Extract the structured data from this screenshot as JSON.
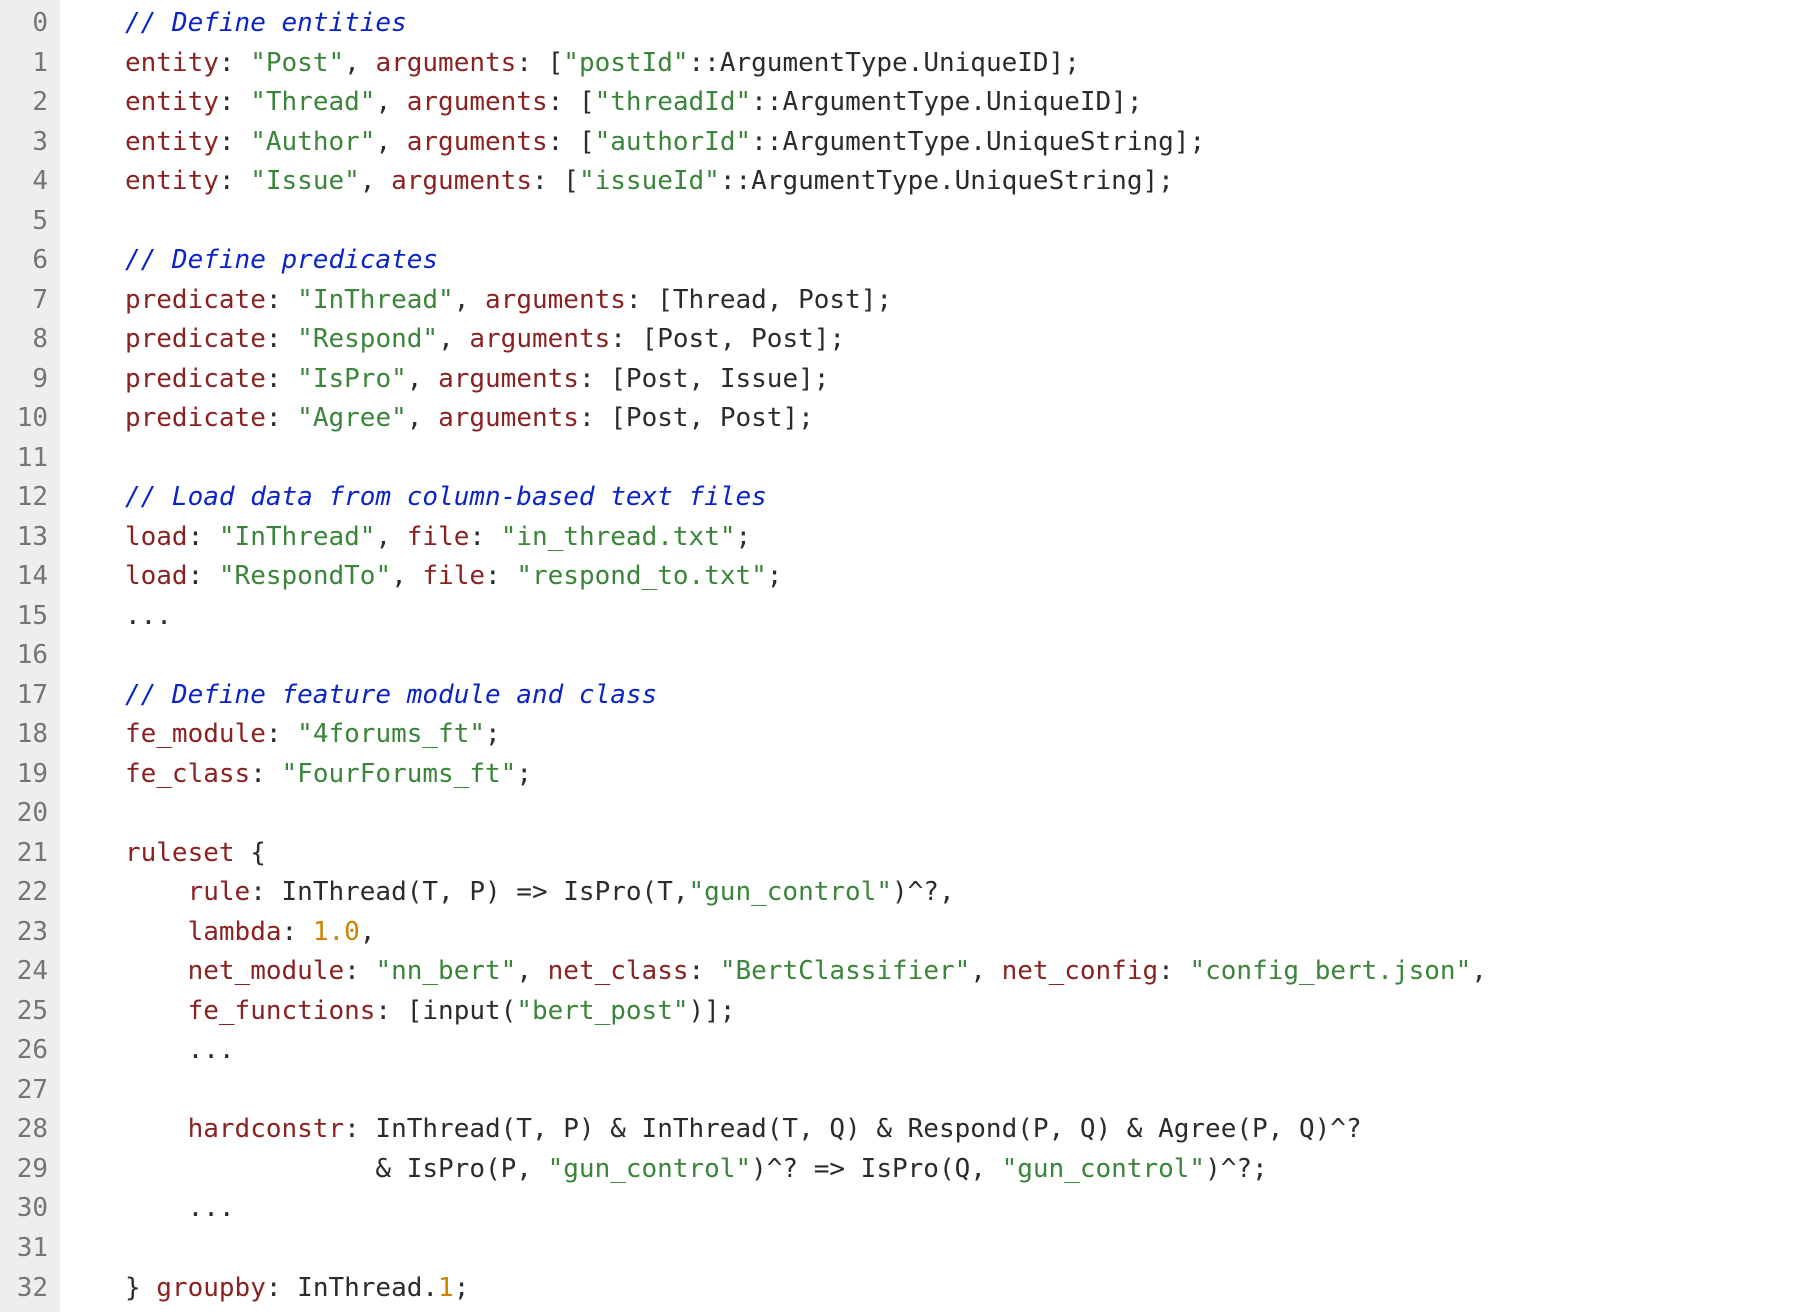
{
  "lines": [
    {
      "n": "0",
      "tokens": [
        [
          "txt",
          "   "
        ],
        [
          "comment",
          "// Define entities"
        ]
      ]
    },
    {
      "n": "1",
      "tokens": [
        [
          "txt",
          "   "
        ],
        [
          "key",
          "entity"
        ],
        [
          "txt",
          ": "
        ],
        [
          "str",
          "\"Post\""
        ],
        [
          "txt",
          ", "
        ],
        [
          "key",
          "arguments"
        ],
        [
          "txt",
          ": ["
        ],
        [
          "str",
          "\"postId\""
        ],
        [
          "txt",
          "::ArgumentType.UniqueID];"
        ]
      ]
    },
    {
      "n": "2",
      "tokens": [
        [
          "txt",
          "   "
        ],
        [
          "key",
          "entity"
        ],
        [
          "txt",
          ": "
        ],
        [
          "str",
          "\"Thread\""
        ],
        [
          "txt",
          ", "
        ],
        [
          "key",
          "arguments"
        ],
        [
          "txt",
          ": ["
        ],
        [
          "str",
          "\"threadId\""
        ],
        [
          "txt",
          "::ArgumentType.UniqueID];"
        ]
      ]
    },
    {
      "n": "3",
      "tokens": [
        [
          "txt",
          "   "
        ],
        [
          "key",
          "entity"
        ],
        [
          "txt",
          ": "
        ],
        [
          "str",
          "\"Author\""
        ],
        [
          "txt",
          ", "
        ],
        [
          "key",
          "arguments"
        ],
        [
          "txt",
          ": ["
        ],
        [
          "str",
          "\"authorId\""
        ],
        [
          "txt",
          "::ArgumentType.UniqueString];"
        ]
      ]
    },
    {
      "n": "4",
      "tokens": [
        [
          "txt",
          "   "
        ],
        [
          "key",
          "entity"
        ],
        [
          "txt",
          ": "
        ],
        [
          "str",
          "\"Issue\""
        ],
        [
          "txt",
          ", "
        ],
        [
          "key",
          "arguments"
        ],
        [
          "txt",
          ": ["
        ],
        [
          "str",
          "\"issueId\""
        ],
        [
          "txt",
          "::ArgumentType.UniqueString];"
        ]
      ]
    },
    {
      "n": "5",
      "tokens": [
        [
          "txt",
          " "
        ]
      ]
    },
    {
      "n": "6",
      "tokens": [
        [
          "txt",
          "   "
        ],
        [
          "comment",
          "// Define predicates"
        ]
      ]
    },
    {
      "n": "7",
      "tokens": [
        [
          "txt",
          "   "
        ],
        [
          "key",
          "predicate"
        ],
        [
          "txt",
          ": "
        ],
        [
          "str",
          "\"InThread\""
        ],
        [
          "txt",
          ", "
        ],
        [
          "key",
          "arguments"
        ],
        [
          "txt",
          ": [Thread, Post];"
        ]
      ]
    },
    {
      "n": "8",
      "tokens": [
        [
          "txt",
          "   "
        ],
        [
          "key",
          "predicate"
        ],
        [
          "txt",
          ": "
        ],
        [
          "str",
          "\"Respond\""
        ],
        [
          "txt",
          ", "
        ],
        [
          "key",
          "arguments"
        ],
        [
          "txt",
          ": [Post, Post];"
        ]
      ]
    },
    {
      "n": "9",
      "tokens": [
        [
          "txt",
          "   "
        ],
        [
          "key",
          "predicate"
        ],
        [
          "txt",
          ": "
        ],
        [
          "str",
          "\"IsPro\""
        ],
        [
          "txt",
          ", "
        ],
        [
          "key",
          "arguments"
        ],
        [
          "txt",
          ": [Post, Issue];"
        ]
      ]
    },
    {
      "n": "10",
      "tokens": [
        [
          "txt",
          "   "
        ],
        [
          "key",
          "predicate"
        ],
        [
          "txt",
          ": "
        ],
        [
          "str",
          "\"Agree\""
        ],
        [
          "txt",
          ", "
        ],
        [
          "key",
          "arguments"
        ],
        [
          "txt",
          ": [Post, Post];"
        ]
      ]
    },
    {
      "n": "11",
      "tokens": [
        [
          "txt",
          " "
        ]
      ]
    },
    {
      "n": "12",
      "tokens": [
        [
          "txt",
          "   "
        ],
        [
          "comment",
          "// Load data from column-based text files"
        ]
      ]
    },
    {
      "n": "13",
      "tokens": [
        [
          "txt",
          "   "
        ],
        [
          "key",
          "load"
        ],
        [
          "txt",
          ": "
        ],
        [
          "str",
          "\"InThread\""
        ],
        [
          "txt",
          ", "
        ],
        [
          "key",
          "file"
        ],
        [
          "txt",
          ": "
        ],
        [
          "str",
          "\"in_thread.txt\""
        ],
        [
          "txt",
          ";"
        ]
      ]
    },
    {
      "n": "14",
      "tokens": [
        [
          "txt",
          "   "
        ],
        [
          "key",
          "load"
        ],
        [
          "txt",
          ": "
        ],
        [
          "str",
          "\"RespondTo\""
        ],
        [
          "txt",
          ", "
        ],
        [
          "key",
          "file"
        ],
        [
          "txt",
          ": "
        ],
        [
          "str",
          "\"respond_to.txt\""
        ],
        [
          "txt",
          ";"
        ]
      ]
    },
    {
      "n": "15",
      "tokens": [
        [
          "txt",
          "   ..."
        ]
      ]
    },
    {
      "n": "16",
      "tokens": [
        [
          "txt",
          " "
        ]
      ]
    },
    {
      "n": "17",
      "tokens": [
        [
          "txt",
          "   "
        ],
        [
          "comment",
          "// Define feature module and class"
        ]
      ]
    },
    {
      "n": "18",
      "tokens": [
        [
          "txt",
          "   "
        ],
        [
          "key",
          "fe_module"
        ],
        [
          "txt",
          ": "
        ],
        [
          "str",
          "\"4forums_ft\""
        ],
        [
          "txt",
          ";"
        ]
      ]
    },
    {
      "n": "19",
      "tokens": [
        [
          "txt",
          "   "
        ],
        [
          "key",
          "fe_class"
        ],
        [
          "txt",
          ": "
        ],
        [
          "str",
          "\"FourForums_ft\""
        ],
        [
          "txt",
          ";"
        ]
      ]
    },
    {
      "n": "20",
      "tokens": [
        [
          "txt",
          " "
        ]
      ]
    },
    {
      "n": "21",
      "tokens": [
        [
          "txt",
          "   "
        ],
        [
          "key",
          "ruleset"
        ],
        [
          "txt",
          " {"
        ]
      ]
    },
    {
      "n": "22",
      "tokens": [
        [
          "txt",
          "       "
        ],
        [
          "key",
          "rule"
        ],
        [
          "txt",
          ": InThread(T, P) => IsPro(T,"
        ],
        [
          "str",
          "\"gun_control\""
        ],
        [
          "txt",
          ")^?,"
        ]
      ]
    },
    {
      "n": "23",
      "tokens": [
        [
          "txt",
          "       "
        ],
        [
          "key",
          "lambda"
        ],
        [
          "txt",
          ": "
        ],
        [
          "num",
          "1.0"
        ],
        [
          "txt",
          ","
        ]
      ]
    },
    {
      "n": "24",
      "tokens": [
        [
          "txt",
          "       "
        ],
        [
          "key",
          "net_module"
        ],
        [
          "txt",
          ": "
        ],
        [
          "str",
          "\"nn_bert\""
        ],
        [
          "txt",
          ", "
        ],
        [
          "key",
          "net_class"
        ],
        [
          "txt",
          ": "
        ],
        [
          "str",
          "\"BertClassifier\""
        ],
        [
          "txt",
          ", "
        ],
        [
          "key",
          "net_config"
        ],
        [
          "txt",
          ": "
        ],
        [
          "str",
          "\"config_bert.json\""
        ],
        [
          "txt",
          ","
        ]
      ]
    },
    {
      "n": "25",
      "tokens": [
        [
          "txt",
          "       "
        ],
        [
          "key",
          "fe_functions"
        ],
        [
          "txt",
          ": [input("
        ],
        [
          "str",
          "\"bert_post\""
        ],
        [
          "txt",
          ")];"
        ]
      ]
    },
    {
      "n": "26",
      "tokens": [
        [
          "txt",
          "       ..."
        ]
      ]
    },
    {
      "n": "27",
      "tokens": [
        [
          "txt",
          " "
        ]
      ]
    },
    {
      "n": "28",
      "tokens": [
        [
          "txt",
          "       "
        ],
        [
          "key",
          "hardconstr"
        ],
        [
          "txt",
          ": InThread(T, P) & InThread(T, Q) & Respond(P, Q) & Agree(P, Q)^?"
        ]
      ]
    },
    {
      "n": "29",
      "tokens": [
        [
          "txt",
          "                   & IsPro(P, "
        ],
        [
          "str",
          "\"gun_control\""
        ],
        [
          "txt",
          ")^? => IsPro(Q, "
        ],
        [
          "str",
          "\"gun_control\""
        ],
        [
          "txt",
          ")^?;"
        ]
      ]
    },
    {
      "n": "30",
      "tokens": [
        [
          "txt",
          "       ..."
        ]
      ]
    },
    {
      "n": "31",
      "tokens": [
        [
          "txt",
          " "
        ]
      ]
    },
    {
      "n": "32",
      "tokens": [
        [
          "txt",
          "   } "
        ],
        [
          "key",
          "groupby"
        ],
        [
          "txt",
          ": InThread."
        ],
        [
          "num",
          "1"
        ],
        [
          "txt",
          ";"
        ]
      ]
    }
  ]
}
